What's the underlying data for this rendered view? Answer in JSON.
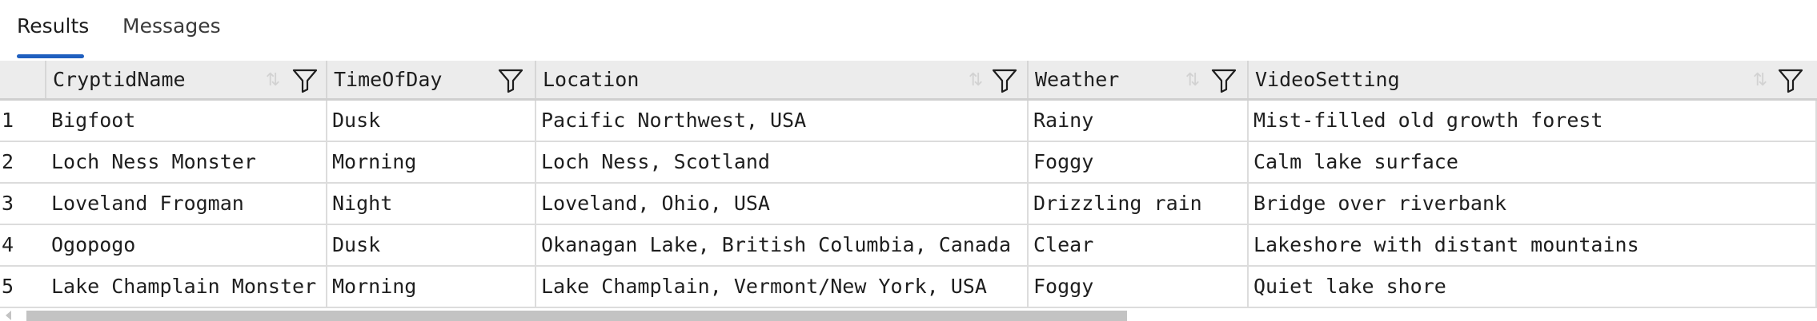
{
  "tabs": {
    "results_label": "Results",
    "messages_label": "Messages",
    "active": "Results"
  },
  "grid": {
    "columns": [
      {
        "label": "CryptidName"
      },
      {
        "label": "TimeOfDay"
      },
      {
        "label": "Location"
      },
      {
        "label": "Weather"
      },
      {
        "label": "VideoSetting"
      }
    ],
    "rows": [
      {
        "num": "1",
        "cells": [
          "Bigfoot",
          "Dusk",
          "Pacific Northwest, USA",
          "Rainy",
          "Mist-filled old growth forest"
        ]
      },
      {
        "num": "2",
        "cells": [
          "Loch Ness Monster",
          "Morning",
          "Loch Ness, Scotland",
          "Foggy",
          "Calm lake surface"
        ]
      },
      {
        "num": "3",
        "cells": [
          "Loveland Frogman",
          "Night",
          "Loveland, Ohio, USA",
          "Drizzling rain",
          "Bridge over riverbank"
        ]
      },
      {
        "num": "4",
        "cells": [
          "Ogopogo",
          "Dusk",
          "Okanagan Lake, British Columbia, Canada",
          "Clear",
          "Lakeshore with distant mountains"
        ]
      },
      {
        "num": "5",
        "cells": [
          "Lake Champlain Monster",
          "Morning",
          "Lake Champlain, Vermont/New York, USA",
          "Foggy",
          "Quiet lake shore"
        ]
      }
    ]
  },
  "icons": {
    "sort": "sort-icon",
    "filter": "filter-icon",
    "scroll_left": "chevron-left-icon"
  },
  "colors": {
    "accent": "#1f5fbf",
    "header_bg": "#ececec",
    "scroll_thumb": "#c3c3c3"
  }
}
